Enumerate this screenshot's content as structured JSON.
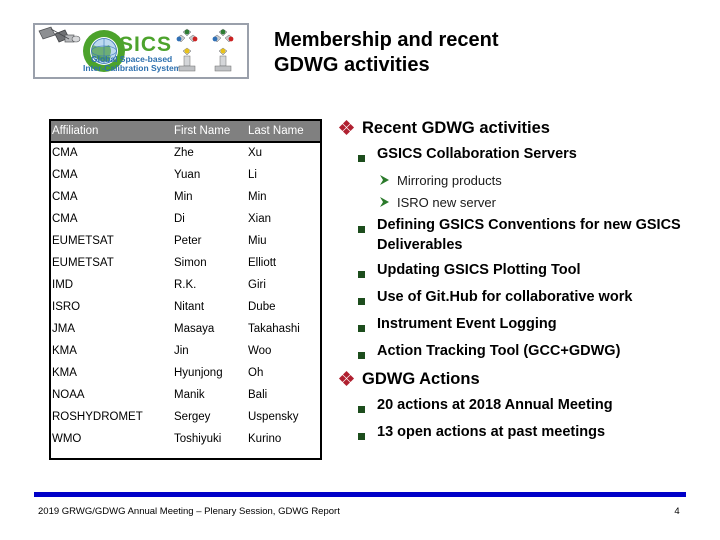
{
  "slide": {
    "title": "Membership and recent GDWG activities",
    "title_line1": "Membership and recent",
    "title_line2": "GDWG activities"
  },
  "logo": {
    "name": "gsics-logo",
    "brand_letter": "G",
    "brand_text": "SICS",
    "tagline_line1": "Global Space-based",
    "tagline_line2": "Inter-Calibration System",
    "colors": {
      "green": "#4ca32c",
      "globe_blue": "#2f6fb5",
      "border": "#9aa0ab"
    }
  },
  "table": {
    "name": "membership-table",
    "header_bg": "#808080",
    "headers": [
      "Affiliation",
      "First Name",
      "Last Name"
    ],
    "rows": [
      [
        "CMA",
        "Zhe",
        "Xu"
      ],
      [
        "CMA",
        "Yuan",
        "Li"
      ],
      [
        "CMA",
        "Min",
        "Min"
      ],
      [
        "CMA",
        "Di",
        "Xian"
      ],
      [
        "EUMETSAT",
        "Peter",
        "Miu"
      ],
      [
        "EUMETSAT",
        "Simon",
        "Elliott"
      ],
      [
        "IMD",
        "R.K.",
        "Giri"
      ],
      [
        "ISRO",
        "Nitant",
        "Dube"
      ],
      [
        "JMA",
        "Masaya",
        "Takahashi"
      ],
      [
        "KMA",
        "Jin",
        "Woo"
      ],
      [
        "KMA",
        "Hyunjong",
        "Oh"
      ],
      [
        "NOAA",
        "Manik",
        "Bali"
      ],
      [
        "ROSHYDROMET",
        "Sergey",
        "Uspensky"
      ],
      [
        "WMO",
        "Toshiyuki",
        "Kurino"
      ]
    ]
  },
  "bullets": {
    "diamond_color": "#b02030",
    "square_color": "#1d4d1d",
    "arrow_color": "#2b7a2b",
    "items": [
      {
        "level": 1,
        "marker": "diamond-bullet-icon",
        "text": "Recent GDWG activities"
      },
      {
        "level": 2,
        "marker": "square-bullet-icon",
        "text": "GSICS Collaboration Servers"
      },
      {
        "level": 3,
        "marker": "arrow-bullet-icon",
        "text": "Mirroring products"
      },
      {
        "level": 3,
        "marker": "arrow-bullet-icon",
        "text": "ISRO new server"
      },
      {
        "level": 2,
        "marker": "square-bullet-icon",
        "text": "Defining GSICS Conventions for new GSICS Deliverables"
      },
      {
        "level": 2,
        "marker": "square-bullet-icon",
        "text": "Updating GSICS Plotting Tool"
      },
      {
        "level": 2,
        "marker": "square-bullet-icon",
        "text": "Use of Git.Hub for collaborative work"
      },
      {
        "level": 2,
        "marker": "square-bullet-icon",
        "text": "Instrument Event Logging"
      },
      {
        "level": 2,
        "marker": "square-bullet-icon",
        "text": "Action Tracking Tool (GCC+GDWG)"
      },
      {
        "level": 1,
        "marker": "diamond-bullet-icon",
        "text": "GDWG Actions"
      },
      {
        "level": 2,
        "marker": "square-bullet-icon",
        "text": "20 actions at 2018 Annual Meeting"
      },
      {
        "level": 2,
        "marker": "square-bullet-icon",
        "text": "13 open actions at past meetings"
      }
    ]
  },
  "footer": {
    "bar_color": "#0000c8",
    "text": "2019 GRWG/GDWG Annual Meeting – Plenary Session, GDWG Report",
    "page_number": "4"
  }
}
